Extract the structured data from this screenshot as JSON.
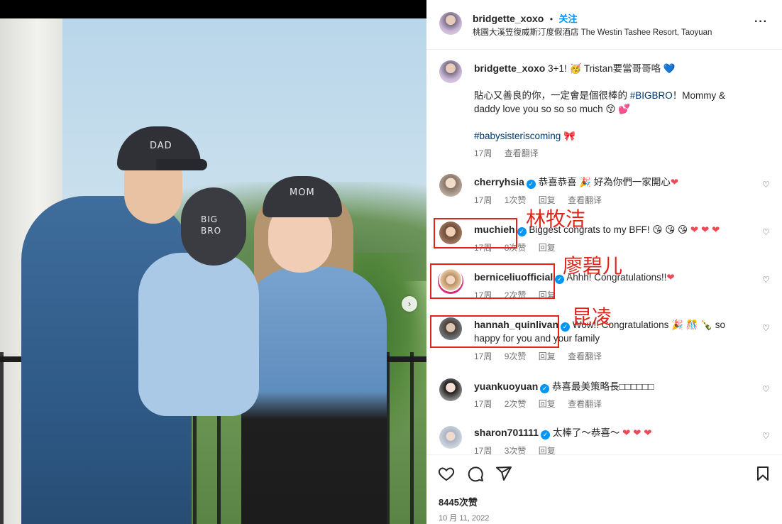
{
  "photo": {
    "cap_dad": "DAD",
    "cap_kid_line1": "BIG",
    "cap_kid_line2": "BRO",
    "cap_mom": "MOM"
  },
  "header": {
    "username": "bridgette_xoxo",
    "separator": "•",
    "follow_label": "关注",
    "location": "桃園大溪笠復威斯汀度假酒店 The Westin Tashee Resort, Taoyuan",
    "more_label": "···"
  },
  "caption": {
    "username": "bridgette_xoxo",
    "line1": "3+1! 🥳 Tristan要當哥哥咯",
    "line1_heart": "💙",
    "line2_pre": "貼心又善良的你，一定會是個很棒的 ",
    "line2_tag": "#BIGBRO",
    "line2_post": "！Mommy & daddy love you so so so much 😚 💕",
    "tag_line": "#babysisteriscoming",
    "tag_emoji": "🎀",
    "time": "17周",
    "translate": "查看翻译"
  },
  "comments": [
    {
      "username": "cherryhsia",
      "verified": true,
      "text": "恭喜恭喜 🎉 好為你們一家開心",
      "hearts": "❤",
      "time": "17周",
      "likes": "1次赞",
      "reply": "回复",
      "translate": "查看翻译"
    },
    {
      "username": "muchieh",
      "verified": true,
      "text": "Biggest congrats to my BFF! 😘 😘 😘",
      "hearts": "❤ ❤ ❤",
      "time": "17周",
      "likes": "8次赞",
      "reply": "回复",
      "translate": ""
    },
    {
      "username": "berniceliuofficial",
      "verified": true,
      "text": "Ahhh! Congratulations!!",
      "hearts": "❤",
      "time": "17周",
      "likes": "2次赞",
      "reply": "回复",
      "translate": ""
    },
    {
      "username": "hannah_quinlivan",
      "verified": true,
      "text": "Wow!! Congratulations 🎉 🎊 🍾 so happy for you and your family",
      "hearts": "",
      "time": "17周",
      "likes": "9次赞",
      "reply": "回复",
      "translate": "查看翻译"
    },
    {
      "username": "yuankuoyuan",
      "verified": true,
      "text": "恭喜最美策略長□□□□□□",
      "hearts": "",
      "time": "17周",
      "likes": "2次赞",
      "reply": "回复",
      "translate": "查看翻译"
    },
    {
      "username": "sharon701111",
      "verified": true,
      "text": "太棒了～恭喜～",
      "hearts": "❤ ❤ ❤",
      "time": "17周",
      "likes": "3次赞",
      "reply": "回复",
      "translate": ""
    }
  ],
  "annotations": {
    "muchieh": "林牧洁",
    "bernice": "廖碧儿",
    "hannah": "昆凌"
  },
  "footer": {
    "likes": "8445次赞",
    "date": "10 月 11, 2022"
  },
  "icons": {
    "like": "heart-outline-icon",
    "comment": "comment-icon",
    "share": "paper-plane-icon",
    "save": "bookmark-icon",
    "next": "chevron-right-icon",
    "verified": "verified-badge-icon"
  },
  "colors": {
    "follow": "#0095f6",
    "verified": "#0095f6",
    "hashtag": "#00376b",
    "annotation": "#e2231a",
    "meta": "#737373"
  }
}
